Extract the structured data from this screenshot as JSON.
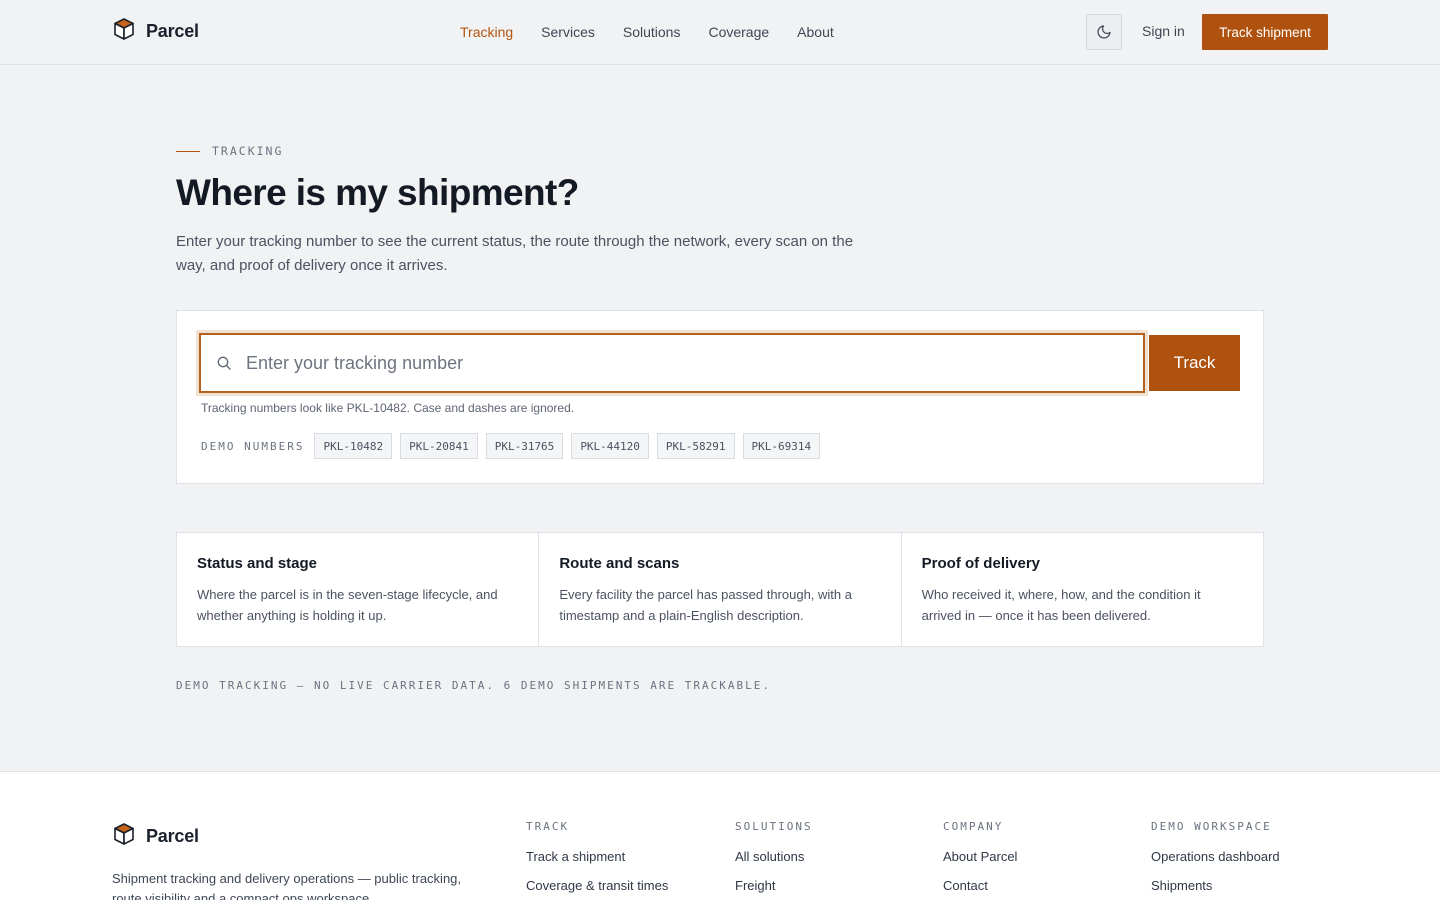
{
  "header": {
    "brand": "Parcel",
    "nav": [
      {
        "label": "Tracking",
        "active": true
      },
      {
        "label": "Services",
        "active": false
      },
      {
        "label": "Solutions",
        "active": false
      },
      {
        "label": "Coverage",
        "active": false
      },
      {
        "label": "About",
        "active": false
      }
    ],
    "theme_icon": "moon-icon",
    "signin": "Sign in",
    "cta": "Track shipment"
  },
  "hero": {
    "eyebrow": "TRACKING",
    "title": "Where is my shipment?",
    "subtitle": "Enter your tracking number to see the current status, the route through the network, every scan on the way, and proof of delivery once it arrives."
  },
  "search": {
    "placeholder": "Enter your tracking number",
    "value": "",
    "button": "Track",
    "hint": "Tracking numbers look like PKL-10482. Case and dashes are ignored.",
    "demo_label": "DEMO NUMBERS",
    "demo_numbers": [
      "PKL-10482",
      "PKL-20841",
      "PKL-31765",
      "PKL-44120",
      "PKL-58291",
      "PKL-69314"
    ]
  },
  "features": [
    {
      "title": "Status and stage",
      "text": "Where the parcel is in the seven-stage lifecycle, and whether anything is holding it up."
    },
    {
      "title": "Route and scans",
      "text": "Every facility the parcel has passed through, with a timestamp and a plain-English description."
    },
    {
      "title": "Proof of delivery",
      "text": "Who received it, where, how, and the condition it arrived in — once it has been delivered."
    }
  ],
  "disclaimer": "DEMO TRACKING — NO LIVE CARRIER DATA. 6 DEMO SHIPMENTS ARE TRACKABLE.",
  "footer": {
    "brand": "Parcel",
    "description": "Shipment tracking and delivery operations — public tracking, route visibility and a compact ops workspace.",
    "columns": [
      {
        "head": "TRACK",
        "links": [
          "Track a shipment",
          "Coverage & transit times"
        ]
      },
      {
        "head": "SOLUTIONS",
        "links": [
          "All solutions",
          "Freight"
        ]
      },
      {
        "head": "COMPANY",
        "links": [
          "About Parcel",
          "Contact"
        ]
      },
      {
        "head": "DEMO WORKSPACE",
        "links": [
          "Operations dashboard",
          "Shipments"
        ]
      }
    ]
  },
  "colors": {
    "accent": "#b0520f",
    "background": "#f1f2f4",
    "text": "#131a24"
  }
}
